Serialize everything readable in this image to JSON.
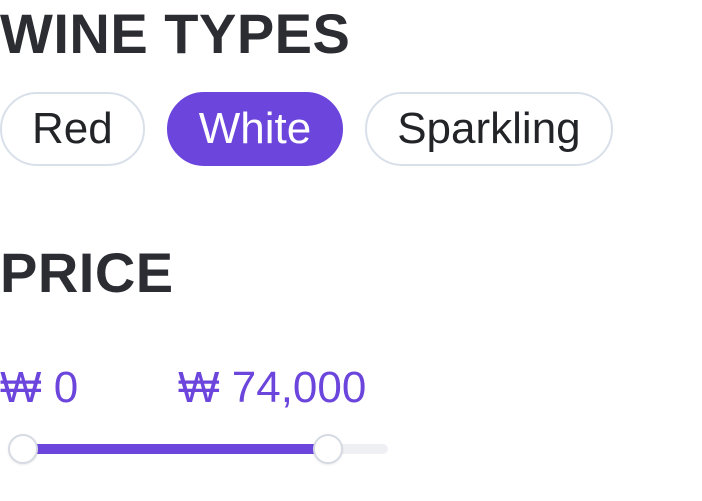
{
  "wine_types": {
    "title": "WINE TYPES",
    "options": [
      {
        "label": "Red",
        "selected": false
      },
      {
        "label": "White",
        "selected": true
      },
      {
        "label": "Sparkling",
        "selected": false
      }
    ]
  },
  "price": {
    "title": "PRICE",
    "min_label": "₩ 0",
    "max_label": "₩ 74,000",
    "min_value": 0,
    "max_value": 74000,
    "range_fraction_start": 0.0,
    "range_fraction_end": 0.87
  },
  "colors": {
    "accent": "#6b45dc",
    "chip_border": "#d9e0ea",
    "title_text": "#2b2d33",
    "track": "#eef0f4"
  }
}
